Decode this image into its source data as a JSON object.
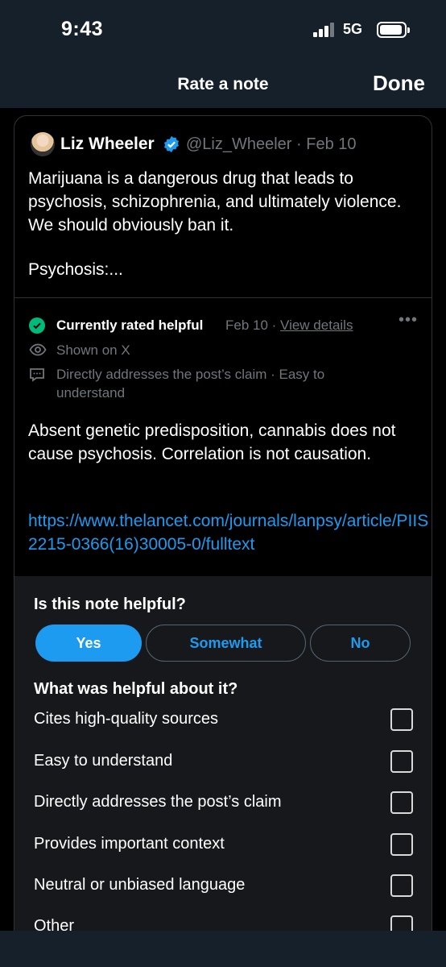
{
  "status_bar": {
    "time": "9:43",
    "network": "5G"
  },
  "nav": {
    "title": "Rate a note",
    "done_label": "Done"
  },
  "post": {
    "author": "Liz Wheeler",
    "handle_date": "@Liz_Wheeler · Feb 10",
    "text": "Marijuana is a dangerous drug that leads to psychosis, schizophrenia, and ultimately violence. We should obviously ban it.",
    "text_more": "Psychosis:..."
  },
  "note": {
    "status": "Currently rated helpful",
    "date": "Feb 10 · ",
    "view_details": "View details",
    "shown_on": "Shown on X",
    "reasons": "Directly addresses the post’s claim · Easy to understand",
    "body": "Absent genetic predisposition, cannabis does not cause psychosis. Correlation is not causation.",
    "link": "https://www.thelancet.com/journals/lanpsy/article/PIIS2215-0366(16)30005-0/fulltext"
  },
  "rating": {
    "question": "Is this note helpful?",
    "options": [
      "Yes",
      "Somewhat",
      "No"
    ],
    "selected": "Yes",
    "followup": "What was helpful about it?",
    "reasons": [
      "Cites high-quality sources",
      "Easy to understand",
      "Directly addresses the post’s claim",
      "Provides important context",
      "Neutral or unbiased language",
      "Other"
    ]
  },
  "colors": {
    "accent": "#1d9bf0",
    "helpful": "#00ba7c",
    "background": "#000000",
    "header": "#15202b"
  }
}
